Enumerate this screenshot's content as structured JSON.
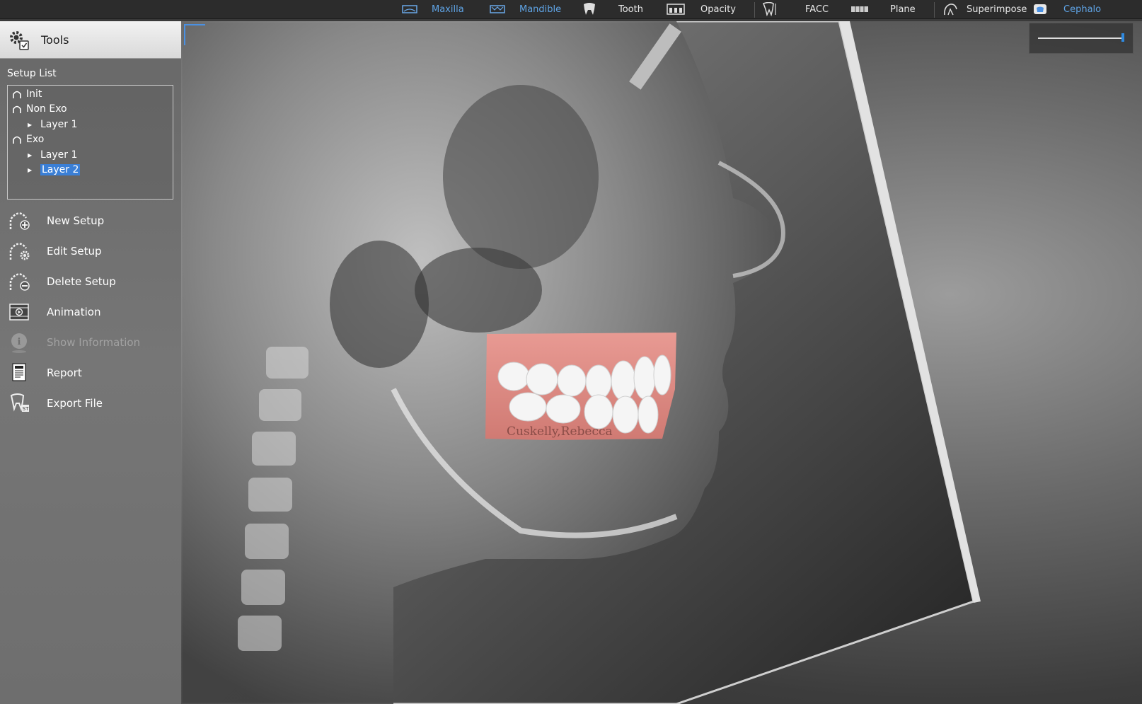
{
  "toolbar": {
    "items": [
      {
        "label": "Maxilla",
        "icon": "maxilla-icon",
        "active": true
      },
      {
        "label": "Mandible",
        "icon": "mandible-icon",
        "active": true
      },
      {
        "label": "Tooth",
        "icon": "tooth-icon",
        "active": false
      },
      {
        "label": "Opacity",
        "icon": "opacity-icon",
        "active": false
      },
      {
        "label": "FACC",
        "icon": "facc-icon",
        "active": false
      },
      {
        "label": "Plane",
        "icon": "plane-icon",
        "active": false
      },
      {
        "label": "Superimpose",
        "icon": "superimpose-icon",
        "active": false
      },
      {
        "label": "Cephalo",
        "icon": "cephalo-icon",
        "active": true
      }
    ],
    "active_color": "#5fa4e6"
  },
  "left_panel": {
    "header_title": "Tools",
    "setup_list_label": "Setup List",
    "setup_tree": [
      {
        "label": "Init",
        "level": 0
      },
      {
        "label": "Non Exo",
        "level": 0
      },
      {
        "label": "Layer 1",
        "level": 1
      },
      {
        "label": "Exo",
        "level": 0
      },
      {
        "label": "Layer 1",
        "level": 1
      },
      {
        "label": "Layer 2",
        "level": 1,
        "selected": true
      }
    ],
    "actions": [
      {
        "label": "New Setup",
        "icon": "new-setup-icon",
        "enabled": true
      },
      {
        "label": "Edit Setup",
        "icon": "edit-setup-icon",
        "enabled": true
      },
      {
        "label": "Delete Setup",
        "icon": "delete-setup-icon",
        "enabled": true
      },
      {
        "label": "Animation",
        "icon": "animation-icon",
        "enabled": true
      },
      {
        "label": "Show Information",
        "icon": "info-icon",
        "enabled": false
      },
      {
        "label": "Report",
        "icon": "report-icon",
        "enabled": true
      },
      {
        "label": "Export File",
        "icon": "export-file-icon",
        "enabled": true
      }
    ]
  },
  "viewport": {
    "model_label": "Cuskelly,Rebecca",
    "opacity": 1.0,
    "selection_color": "#3a7fd6"
  }
}
